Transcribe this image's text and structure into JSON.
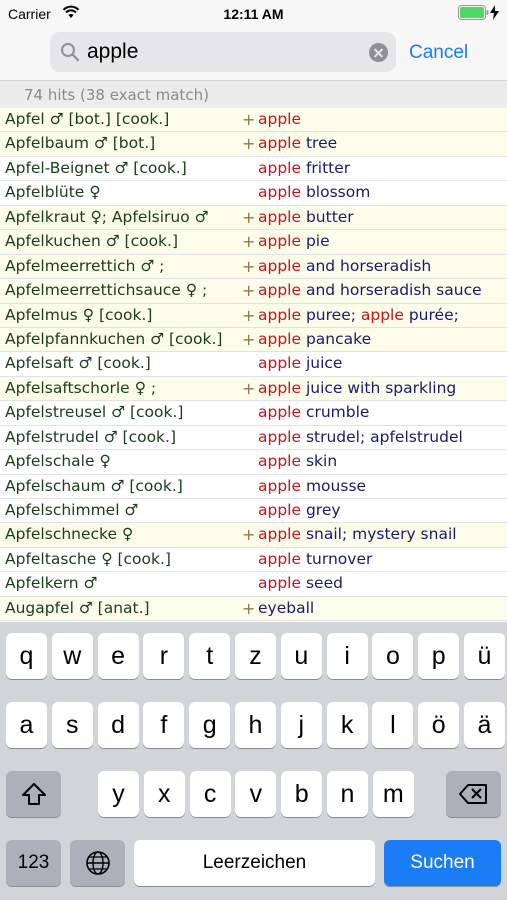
{
  "status_bar": {
    "carrier": "Carrier",
    "time": "12:11 AM"
  },
  "search": {
    "query": "apple",
    "cancel_label": "Cancel"
  },
  "hits_text": "74 hits  (38 exact match)",
  "results": [
    {
      "de": "Apfel ♂  [bot.] [cook.]",
      "plus": true,
      "hl": "apple",
      "rest": ""
    },
    {
      "de": "Apfelbaum ♂  [bot.]",
      "plus": true,
      "hl": "apple",
      "rest": " tree"
    },
    {
      "de": "Apfel-Beignet ♂  [cook.]",
      "plus": false,
      "hl": "apple",
      "rest": " fritter"
    },
    {
      "de": "Apfelblüte ♀",
      "plus": false,
      "hl": "apple",
      "rest": " blossom"
    },
    {
      "de": "Apfelkraut ♀; Apfelsiruo ♂",
      "plus": true,
      "hl": "apple",
      "rest": " butter"
    },
    {
      "de": "Apfelkuchen ♂  [cook.]",
      "plus": true,
      "hl": "apple",
      "rest": " pie"
    },
    {
      "de": "Apfelmeerrettich ♂ ;",
      "plus": true,
      "hl": "apple",
      "rest": " and horseradish"
    },
    {
      "de": "Apfelmeerrettichsauce ♀ ;",
      "plus": true,
      "hl": "apple",
      "rest": " and horseradish sauce"
    },
    {
      "de": "Apfelmus ♀ [cook.]",
      "plus": true,
      "hl": "apple",
      "rest": " puree; ",
      "hl2": "apple",
      "rest2": " purée;"
    },
    {
      "de": "Apfelpfannkuchen ♂  [cook.]",
      "plus": true,
      "hl": "apple",
      "rest": " pancake"
    },
    {
      "de": "Apfelsaft ♂  [cook.]",
      "plus": false,
      "hl": "apple",
      "rest": " juice"
    },
    {
      "de": "Apfelsaftschorle ♀ ;",
      "plus": true,
      "hl": "apple",
      "rest": " juice with sparkling"
    },
    {
      "de": "Apfelstreusel ♂  [cook.]",
      "plus": false,
      "hl": "apple",
      "rest": " crumble"
    },
    {
      "de": "Apfelstrudel ♂  [cook.]",
      "plus": false,
      "hl": "apple",
      "rest": " strudel; apfelstrudel"
    },
    {
      "de": "Apfelschale ♀",
      "plus": false,
      "hl": "apple",
      "rest": " skin"
    },
    {
      "de": "Apfelschaum ♂  [cook.]",
      "plus": false,
      "hl": "apple",
      "rest": " mousse"
    },
    {
      "de": "Apfelschimmel ♂",
      "plus": false,
      "hl": "apple",
      "rest": " grey"
    },
    {
      "de": "Apfelschnecke ♀",
      "plus": true,
      "hl": "apple",
      "rest": " snail; mystery snail"
    },
    {
      "de": "Apfeltasche ♀  [cook.]",
      "plus": false,
      "hl": "apple",
      "rest": " turnover"
    },
    {
      "de": "Apfelkern ♂",
      "plus": false,
      "hl": "apple",
      "rest": " seed"
    },
    {
      "de": "Augapfel ♂  [anat.]",
      "plus": true,
      "hl": "",
      "rest": "eyeball"
    }
  ],
  "keyboard": {
    "row1": [
      "q",
      "w",
      "e",
      "r",
      "t",
      "z",
      "u",
      "i",
      "o",
      "p",
      "ü"
    ],
    "row2": [
      "a",
      "s",
      "d",
      "f",
      "g",
      "h",
      "j",
      "k",
      "l",
      "ö",
      "ä"
    ],
    "row3": [
      "y",
      "x",
      "c",
      "v",
      "b",
      "n",
      "m"
    ],
    "numbers_label": "123",
    "space_label": "Leerzeichen",
    "search_label": "Suchen"
  },
  "icons": [
    "wifi-icon",
    "battery-icon",
    "charging-icon",
    "search-icon",
    "clear-icon",
    "plus-icon",
    "shift-icon",
    "delete-icon",
    "globe-icon"
  ]
}
